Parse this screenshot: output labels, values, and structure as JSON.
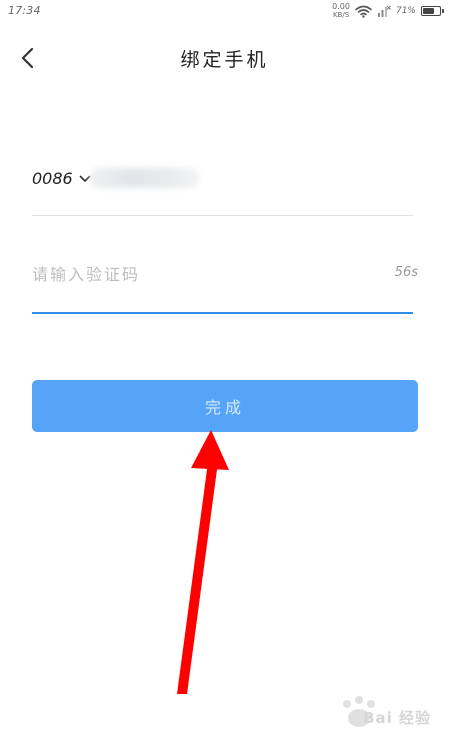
{
  "status_bar": {
    "time": "17:34",
    "net_speed_value": "0.00",
    "net_speed_unit": "KB/S",
    "battery_percent": "71%",
    "battery_level": 0.71
  },
  "header": {
    "title": "绑定手机"
  },
  "phone": {
    "country_code": "0086"
  },
  "verification": {
    "placeholder": "请输入验证码",
    "value": "",
    "countdown": "56s"
  },
  "actions": {
    "submit_label": "完成"
  },
  "watermark": {
    "text": "Bai 经验"
  },
  "colors": {
    "accent": "#2f8ee6",
    "button": "#55a4f7",
    "annotation": "#ff0000"
  }
}
